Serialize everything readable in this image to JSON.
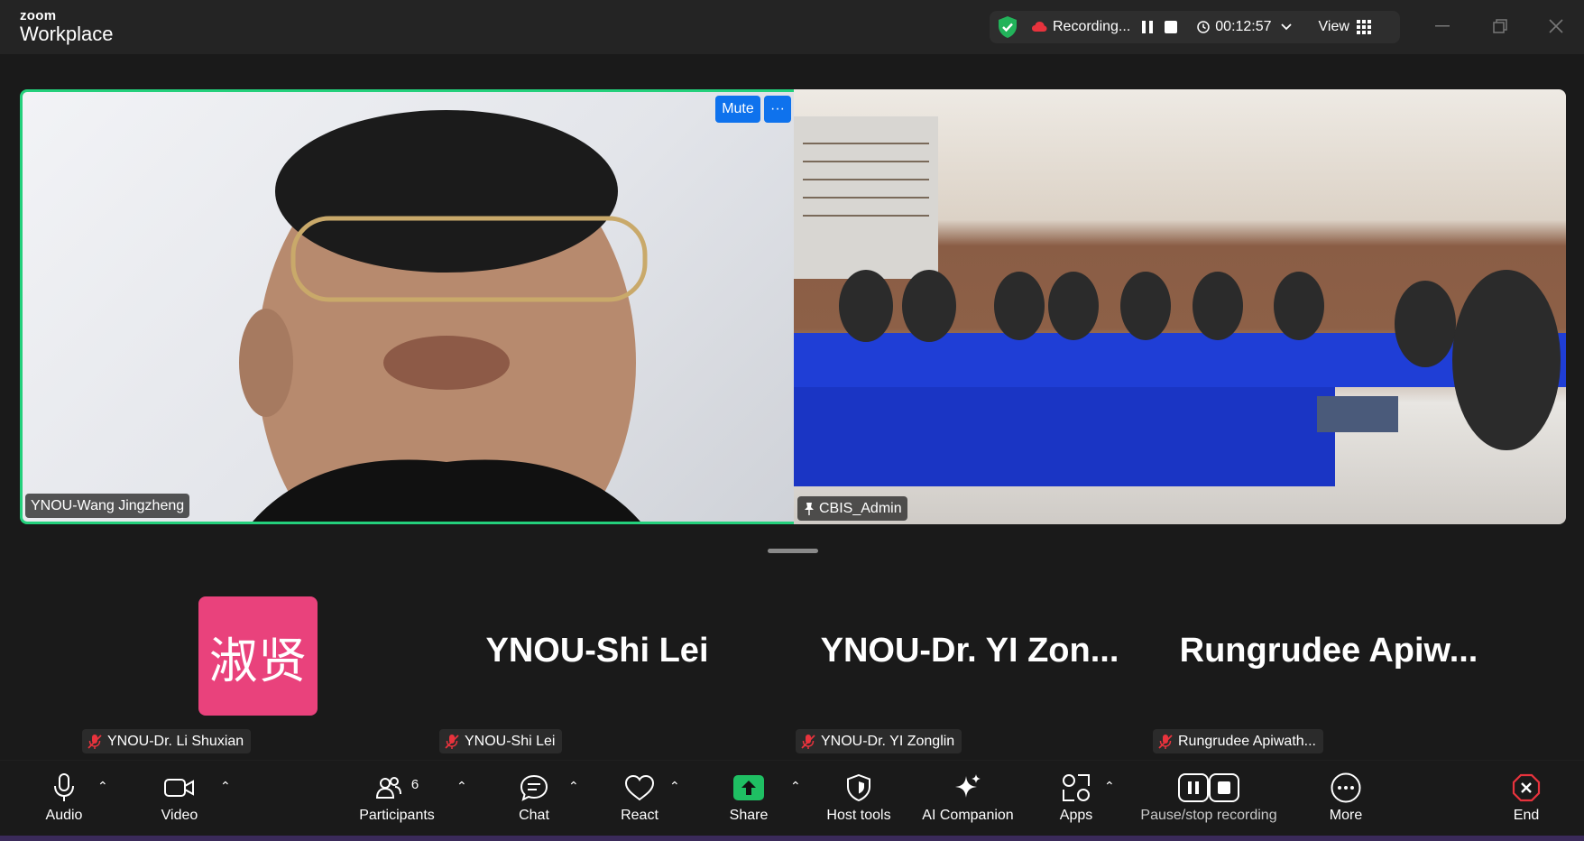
{
  "app": {
    "brand_top": "zoom",
    "brand_bottom": "Workplace"
  },
  "recording": {
    "status": "Recording...",
    "timer": "00:12:57",
    "view_label": "View"
  },
  "tiles": {
    "left_name": "YNOU-Wang Jingzheng",
    "right_name": "CBIS_Admin",
    "mute_label": "Mute",
    "more_label": "···"
  },
  "gallery": [
    {
      "display": "淑贤",
      "tag": "YNOU-Dr. Li Shuxian",
      "mode": "avatar"
    },
    {
      "display": "YNOU-Shi Lei",
      "tag": "YNOU-Shi Lei",
      "mode": "name"
    },
    {
      "display": "YNOU-Dr. YI Zon...",
      "tag": "YNOU-Dr. YI Zonglin",
      "mode": "name"
    },
    {
      "display": "Rungrudee Apiw...",
      "tag": "Rungrudee Apiwath...",
      "mode": "name"
    }
  ],
  "toolbar": {
    "audio": "Audio",
    "video": "Video",
    "participants": "Participants",
    "participants_count": "6",
    "chat": "Chat",
    "react": "React",
    "share": "Share",
    "host_tools": "Host tools",
    "ai_companion": "AI Companion",
    "apps": "Apps",
    "pause_stop": "Pause/stop recording",
    "more": "More",
    "end": "End"
  },
  "colors": {
    "accent_green": "#24d07c",
    "share_green": "#1fbf63",
    "mute_blue": "#0e72ed",
    "avatar_pink": "#e9427c",
    "end_red": "#e8333d"
  }
}
